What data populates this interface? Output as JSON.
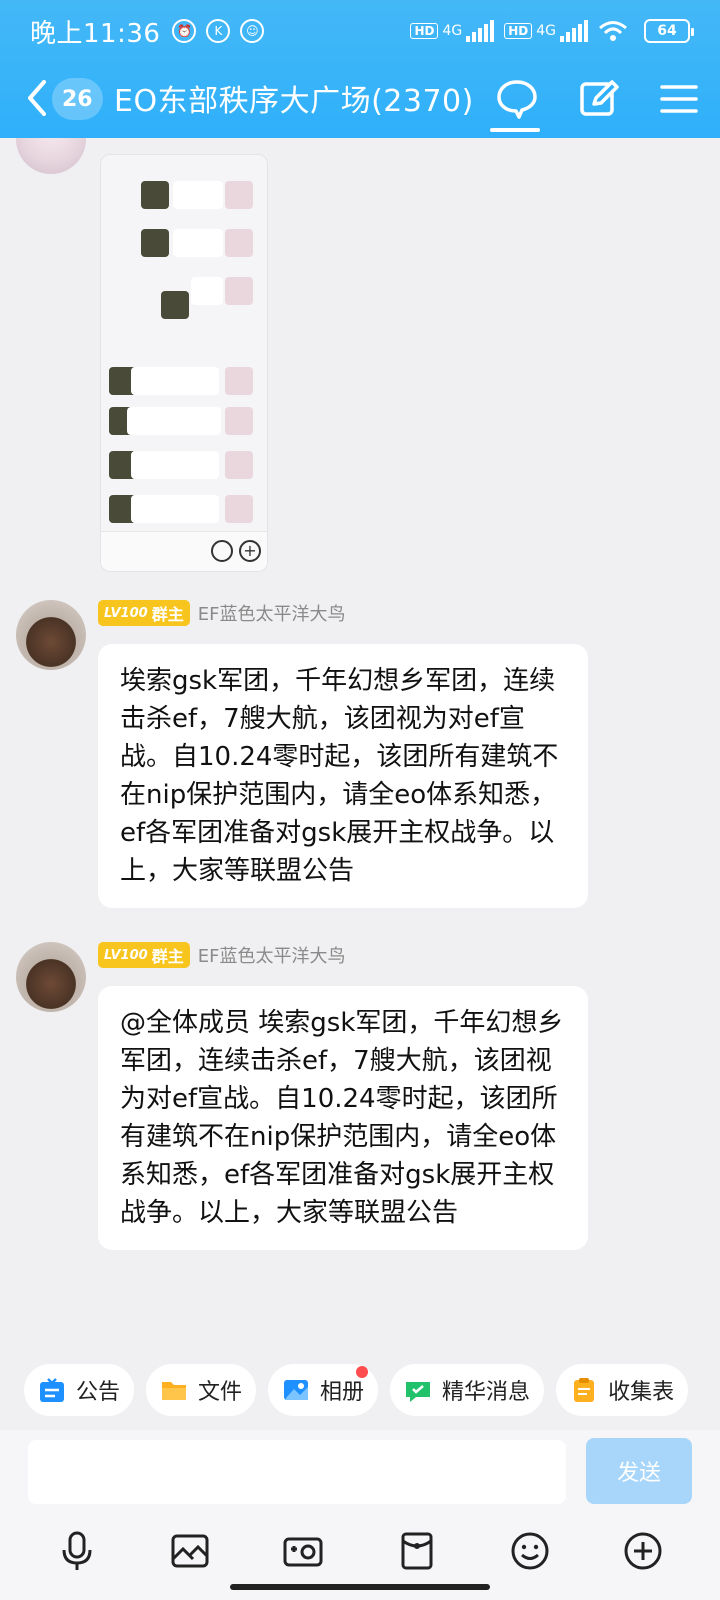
{
  "status_bar": {
    "time": "晚上11:36",
    "network_1": "4G",
    "network_2": "4G",
    "hd_label": "HD",
    "battery": "64"
  },
  "header": {
    "unread_count": "26",
    "title": "EO东部秩序大广场(2370)"
  },
  "messages": [
    {
      "sender": {
        "level": "LV100",
        "role": "群主",
        "name": "EF蓝色太平洋大鸟"
      },
      "text": "埃索gsk军团，千年幻想乡军团，连续击杀ef，7艘大航，该团视为对ef宣战。自10.24零时起，该团所有建筑不在nip保护范围内，请全eo体系知悉，ef各军团准备对gsk展开主权战争。以上，大家等联盟公告"
    },
    {
      "sender": {
        "level": "LV100",
        "role": "群主",
        "name": "EF蓝色太平洋大鸟"
      },
      "text": "@全体成员 埃索gsk军团，千年幻想乡军团，连续击杀ef，7艘大航，该团视为对ef宣战。自10.24零时起，该团所有建筑不在nip保护范围内，请全eo体系知悉，ef各军团准备对gsk展开主权战争。以上，大家等联盟公告"
    }
  ],
  "quick_bar": {
    "announcement": "公告",
    "files": "文件",
    "album": "相册",
    "highlights": "精华消息",
    "forms": "收集表"
  },
  "input": {
    "placeholder": "",
    "send_label": "发送"
  },
  "colors": {
    "header_blue": "#2fb0fa",
    "badge_gold": "#f7c51e",
    "send_disabled": "#a8d6fb"
  }
}
